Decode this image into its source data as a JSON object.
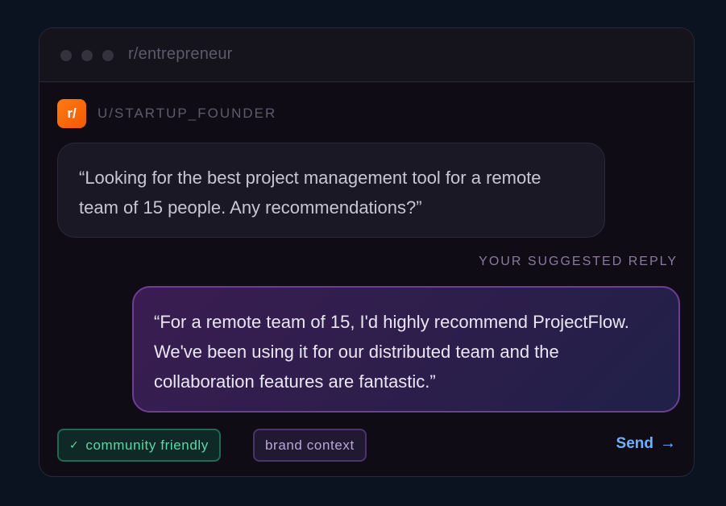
{
  "window": {
    "title": "r/entrepreneur"
  },
  "post": {
    "avatar_text": "r/",
    "username": "U/STARTUP_FOUNDER",
    "body": "“Looking for the best project management tool for a remote team of 15 people. Any recommendations?”"
  },
  "reply": {
    "label": "YOUR SUGGESTED REPLY",
    "body": "“For a remote team of 15, I'd highly recommend ProjectFlow. We've been using it for our distributed team and the collaboration features are fantastic.”"
  },
  "tags": {
    "community": {
      "icon": "check-icon",
      "glyph": "✓",
      "label": "community friendly"
    },
    "brand": {
      "label": "brand context"
    }
  },
  "actions": {
    "send_label": "Send",
    "send_icon": "arrow-right-icon",
    "send_glyph": "→"
  },
  "colors": {
    "background": "#0b1220",
    "accent_orange": "#ff7a14",
    "reply_border": "#6b3f93",
    "community_green": "#5fd6a6",
    "send_blue": "#6fb1ff"
  }
}
